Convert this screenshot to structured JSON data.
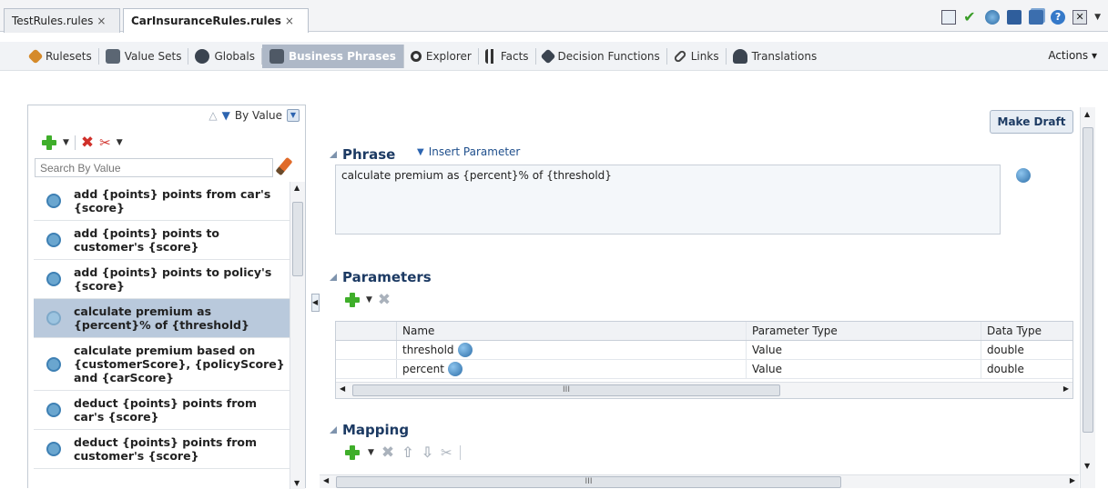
{
  "tabs": [
    {
      "label": "TestRules.rules"
    },
    {
      "label": "CarInsuranceRules.rules"
    }
  ],
  "tab_close": "×",
  "nav": [
    {
      "label": "Rulesets"
    },
    {
      "label": "Value Sets"
    },
    {
      "label": "Globals"
    },
    {
      "label": "Business Phrases"
    },
    {
      "label": "Explorer"
    },
    {
      "label": "Facts"
    },
    {
      "label": "Decision Functions"
    },
    {
      "label": "Links"
    },
    {
      "label": "Translations"
    }
  ],
  "actions_label": "Actions ▾",
  "left": {
    "sort_label": "By Value",
    "search_placeholder": "Search By Value",
    "items": [
      {
        "label": "add {points} points from car's {score}"
      },
      {
        "label": "add {points} points to customer's {score}"
      },
      {
        "label": "add {points} points to policy's {score}"
      },
      {
        "label": "calculate premium as {percent}% of {threshold}"
      },
      {
        "label": "calculate premium based on {customerScore}, {policyScore} and {carScore}"
      },
      {
        "label": "deduct {points} points from car's {score}"
      },
      {
        "label": "deduct {points} points from customer's {score}"
      }
    ]
  },
  "make_draft_label": "Make Draft",
  "phrase": {
    "heading": "Phrase",
    "insert_parameter_label": "Insert Parameter",
    "text": "calculate premium as {percent}% of {threshold}"
  },
  "parameters": {
    "heading": "Parameters",
    "columns": [
      "Name",
      "Parameter Type",
      "Data Type"
    ],
    "rows": [
      {
        "name": "threshold",
        "param_type": "Value",
        "data_type": "double"
      },
      {
        "name": "percent",
        "param_type": "Value",
        "data_type": "double"
      }
    ],
    "scroll_grip": "III"
  },
  "mapping": {
    "heading": "Mapping"
  },
  "bottom_scroll_grip": "III"
}
